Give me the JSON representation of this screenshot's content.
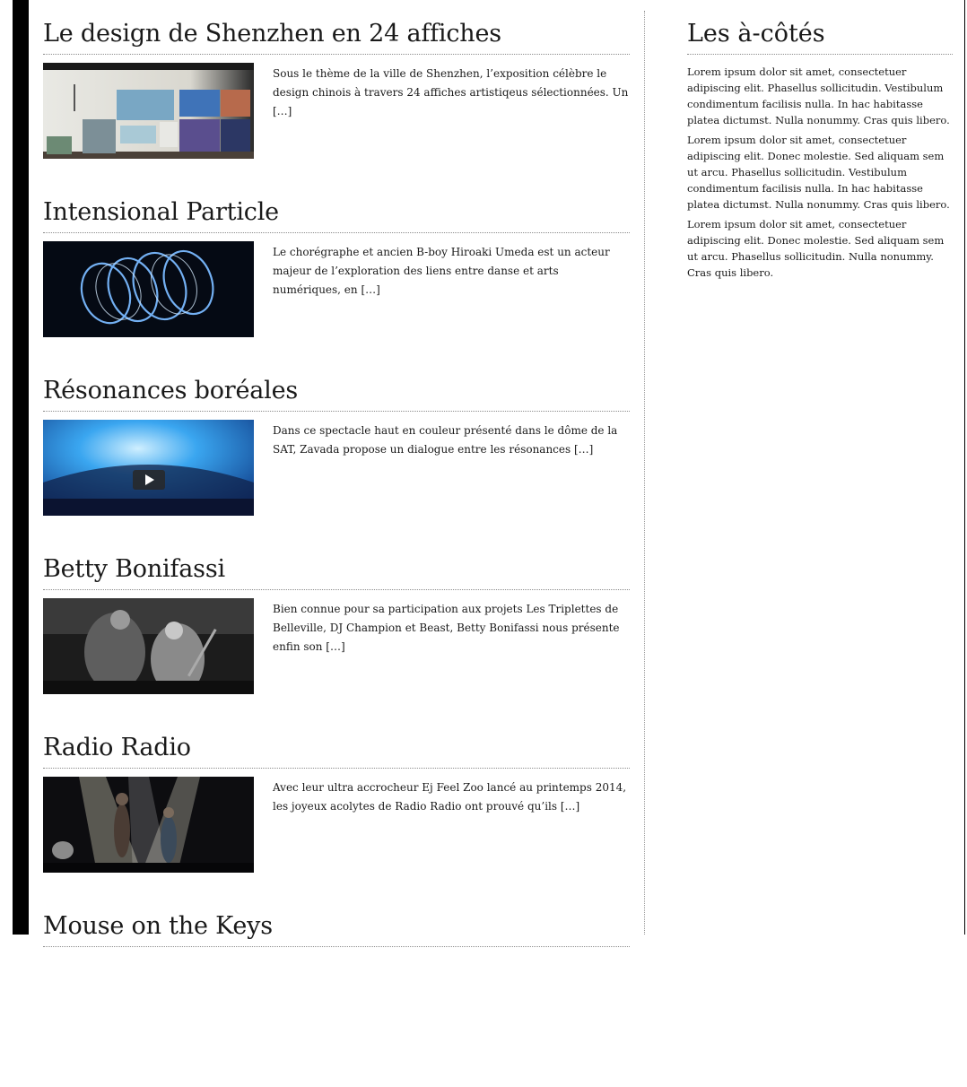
{
  "posts": [
    {
      "title": "Le design de Shenzhen en 24 affiches",
      "excerpt": "Sous le thème de la ville de Shenzhen, l’exposition célèbre le design chinois à travers 24 affiches artistiqeus sélectionnées. Un […]"
    },
    {
      "title": "Intensional Particle",
      "excerpt": "Le chorégraphe et ancien B-boy Hiroaki Umeda est un acteur majeur de l’exploration des liens entre danse et arts numériques, en […]"
    },
    {
      "title": "Résonances boréales",
      "excerpt": "Dans ce spectacle haut en couleur présenté dans le dôme de la SAT, Zavada propose un dialogue entre les résonances […]"
    },
    {
      "title": "Betty Bonifassi",
      "excerpt": "Bien connue pour sa participation aux projets Les Triplettes de Belleville, DJ Champion et Beast, Betty Bonifassi nous présente enfin son […]"
    },
    {
      "title": "Radio Radio",
      "excerpt": "Avec leur ultra accrocheur Ej Feel Zoo lancé au printemps 2014, les joyeux acolytes de Radio Radio ont prouvé qu’ils […]"
    },
    {
      "title": "Mouse on the Keys",
      "excerpt": ""
    }
  ],
  "sidebar": {
    "title": "Les à-côtés",
    "paragraphs": [
      "Lorem ipsum dolor sit amet, consectetuer adipiscing elit. Phasellus sollicitudin. Vestibulum condimentum facilisis nulla. In hac habitasse platea dictumst. Nulla nonummy. Cras quis libero.",
      "Lorem ipsum dolor sit amet, consectetuer adipiscing elit. Donec molestie. Sed aliquam sem ut arcu. Phasellus sollicitudin. Vestibulum condimentum facilisis nulla. In hac habitasse platea dictumst. Nulla nonummy. Cras quis libero.",
      "Lorem ipsum dolor sit amet, consectetuer adipiscing elit. Donec molestie. Sed aliquam sem ut arcu. Phasellus sollicitudin. Nulla nonummy. Cras quis libero."
    ]
  },
  "icons": {
    "video_play": "play-icon"
  }
}
